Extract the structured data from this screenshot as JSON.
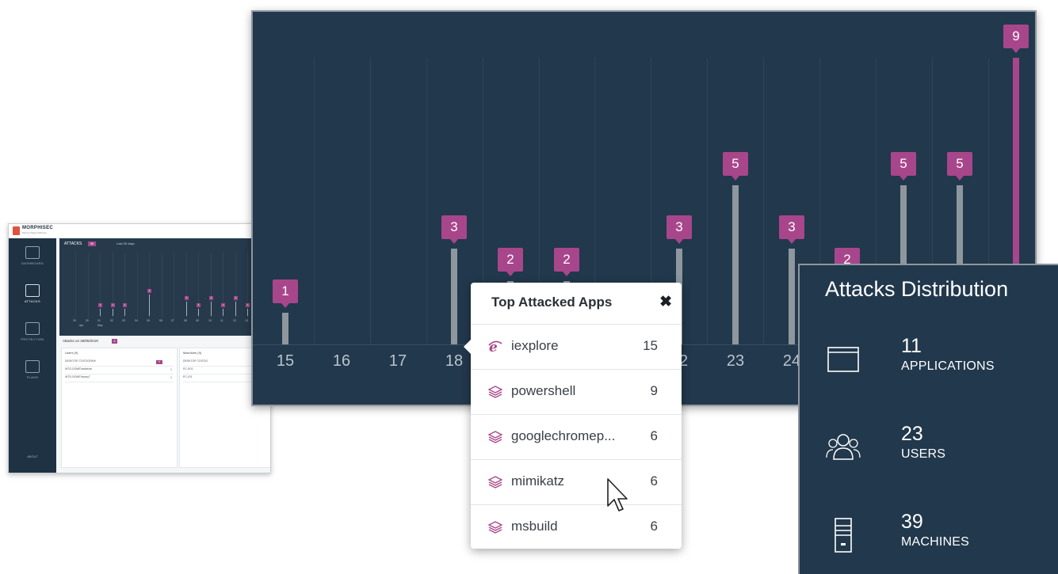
{
  "mini_dashboard": {
    "brand": "MORPHISEC",
    "tagline": "Moving Target Defense",
    "nav": [
      {
        "label": "DASHBOARD",
        "icon": "dashboard-icon"
      },
      {
        "label": "ATTACKS",
        "icon": "swords-icon"
      },
      {
        "label": "PROTECTION",
        "icon": "shield-icon"
      },
      {
        "label": "PLANS",
        "icon": "map-icon"
      }
    ],
    "about": "ABOUT",
    "chart_title": "ATTACKS",
    "chart_badge": "36",
    "range": "Last 30 days",
    "ticks": [
      "29",
      "30",
      "01",
      "02",
      "03",
      "04",
      "05",
      "06",
      "07",
      "08",
      "09",
      "10",
      "11",
      "12",
      "13"
    ],
    "tick_months": [
      "Apr",
      "May"
    ],
    "bar_labels": [
      "1",
      "1",
      "1",
      "3",
      "2",
      "1",
      "2",
      "1",
      "2",
      "1"
    ],
    "attacks_on": "Attacks on 28/05/2019",
    "attacks_on_badge": "9",
    "users_title": "Users (9)",
    "machines_title": "Machines (9)",
    "user_rows": [
      {
        "name": "DESKTOP-TOITOGPAH\\",
        "value": "9"
      },
      {
        "name": "WTD-DOME\\hadtman",
        "value": "1"
      },
      {
        "name": "WTD-DOME\\hisary7",
        "value": "1"
      }
    ],
    "machine_rows": [
      {
        "name": "DESKTOP-TOITOG",
        "value": ""
      },
      {
        "name": "PC-IIO1",
        "value": ""
      },
      {
        "name": "PC-IO1",
        "value": ""
      }
    ]
  },
  "main_chart": {
    "x_ticks": [
      "15",
      "16",
      "17",
      "18",
      "",
      "",
      "",
      "22",
      "23",
      "24",
      "",
      "",
      ""
    ],
    "bar_labels": [
      "1",
      "3",
      "2",
      "2",
      "3",
      "5",
      "3",
      "2",
      "5",
      "5",
      "9"
    ],
    "colors": {
      "bar": "#8d979d",
      "marker": "#a8468b",
      "background": "#22384c"
    }
  },
  "popup": {
    "title": "Top Attacked Apps",
    "close_icon": "close-icon",
    "apps": [
      {
        "name": "iexplore",
        "count": "15",
        "icon": "ie-icon"
      },
      {
        "name": "powershell",
        "count": "9",
        "icon": "layers-icon"
      },
      {
        "name": "googlechromep...",
        "count": "6",
        "icon": "layers-icon"
      },
      {
        "name": "mimikatz",
        "count": "6",
        "icon": "layers-icon"
      },
      {
        "name": "msbuild",
        "count": "6",
        "icon": "layers-icon"
      }
    ]
  },
  "distribution": {
    "title": "Attacks Distribution",
    "items": [
      {
        "number": "11",
        "label": "APPLICATIONS",
        "icon": "window-icon"
      },
      {
        "number": "23",
        "label": "USERS",
        "icon": "users-icon"
      },
      {
        "number": "39",
        "label": "MACHINES",
        "icon": "server-icon"
      }
    ]
  }
}
